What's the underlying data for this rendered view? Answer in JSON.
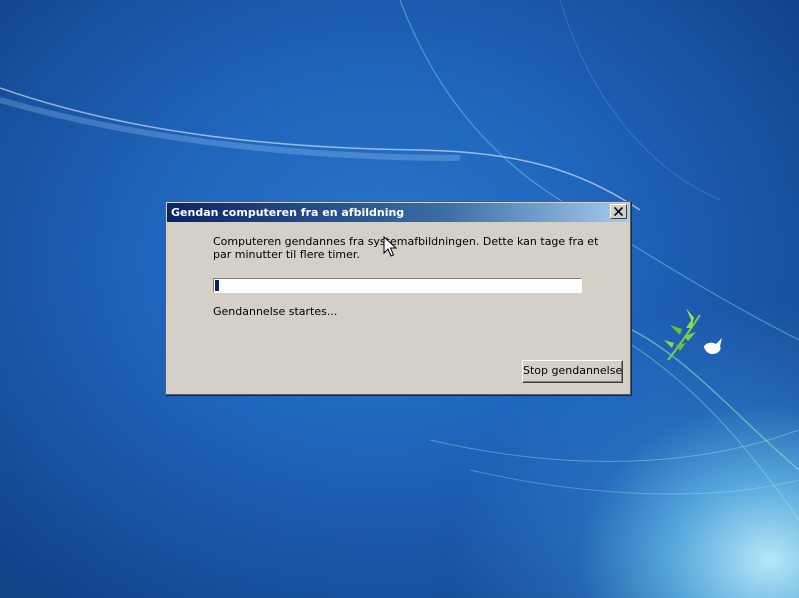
{
  "desktop": {
    "wallpaper": "windows-7-default",
    "icon": "bird-branch-icon"
  },
  "dialog": {
    "title": "Gendan computeren fra en afbildning",
    "close_icon": "close-icon",
    "message": "Computeren gendannes fra systemafbildningen. Dette kan tage fra et par minutter til flere timer.",
    "progress": {
      "percent": 1
    },
    "status": "Gendannelse startes...",
    "stop_button": "Stop gendannelse"
  },
  "colors": {
    "title_bar_start": "#0a246a",
    "title_bar_end": "#a6caf0",
    "dialog_face": "#d4d0c8",
    "progress_fill": "#0a246a"
  },
  "cursor": "arrow-cursor-icon"
}
